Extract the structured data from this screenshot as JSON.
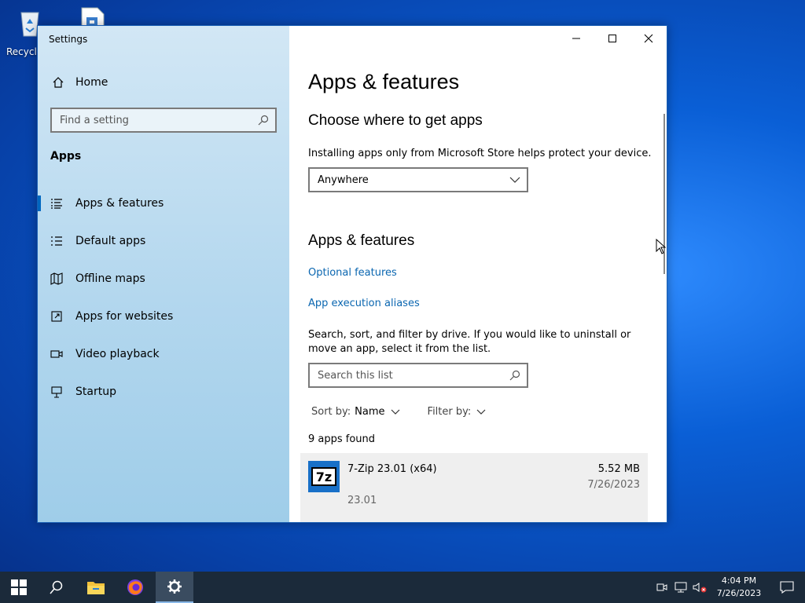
{
  "desktop": {
    "recycle_bin_label": "Recycle"
  },
  "window": {
    "title": "Settings",
    "sidebar": {
      "home_label": "Home",
      "search_placeholder": "Find a setting",
      "section_title": "Apps",
      "items": [
        {
          "label": "Apps & features",
          "icon": "list-icon",
          "active": true
        },
        {
          "label": "Default apps",
          "icon": "default-apps-icon",
          "active": false
        },
        {
          "label": "Offline maps",
          "icon": "map-icon",
          "active": false
        },
        {
          "label": "Apps for websites",
          "icon": "open-in-icon",
          "active": false
        },
        {
          "label": "Video playback",
          "icon": "video-icon",
          "active": false
        },
        {
          "label": "Startup",
          "icon": "startup-icon",
          "active": false
        }
      ]
    },
    "content": {
      "page_title": "Apps & features",
      "choose_heading": "Choose where to get apps",
      "choose_description": "Installing apps only from Microsoft Store helps protect your device.",
      "source_dropdown_value": "Anywhere",
      "features_heading": "Apps & features",
      "optional_features_link": "Optional features",
      "execution_aliases_link": "App execution aliases",
      "search_description": "Search, sort, and filter by drive. If you would like to uninstall or move an app, select it from the list.",
      "search_placeholder": "Search this list",
      "sort_label": "Sort by:",
      "sort_value": "Name",
      "filter_label": "Filter by:",
      "apps_count": "9 apps found",
      "apps": [
        {
          "name": "7-Zip 23.01 (x64)",
          "version": "23.01",
          "size": "5.52 MB",
          "date": "7/26/2023",
          "icon_text": "7z"
        }
      ]
    }
  },
  "taskbar": {
    "time": "4:04 PM",
    "date": "7/26/2023"
  },
  "colors": {
    "accent": "#0067c0",
    "link": "#0a66b0",
    "taskbar": "#1b2a3a"
  }
}
